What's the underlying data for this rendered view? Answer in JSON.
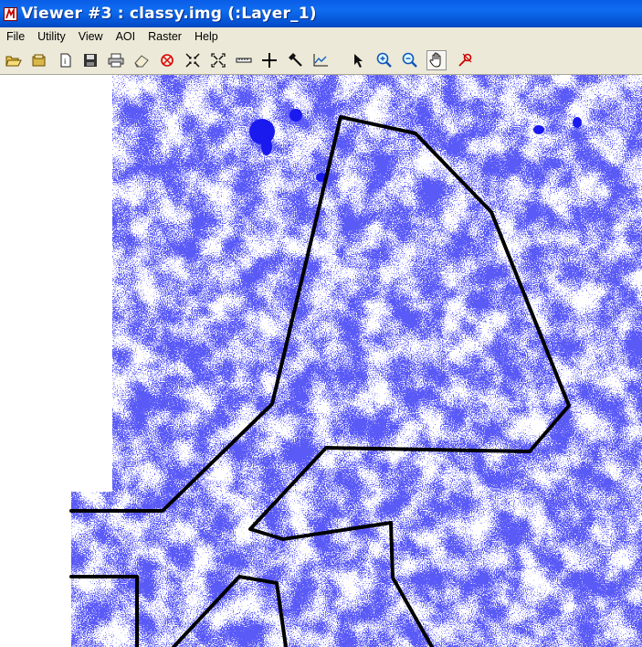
{
  "window": {
    "title": "Viewer #3 : classy.img (:Layer_1)"
  },
  "menu": [
    {
      "label": "File"
    },
    {
      "label": "Utility"
    },
    {
      "label": "View"
    },
    {
      "label": "AOI"
    },
    {
      "label": "Raster"
    },
    {
      "label": "Help"
    }
  ],
  "toolbar": {
    "tools": [
      {
        "icon": "open-folder-icon"
      },
      {
        "icon": "open-layer-icon"
      },
      {
        "icon": "info-page-icon"
      },
      {
        "icon": "save-disk-icon"
      },
      {
        "icon": "printer-icon"
      },
      {
        "icon": "eraser-icon"
      },
      {
        "icon": "red-cross-circle-icon"
      },
      {
        "icon": "zoom-in-arrows-icon"
      },
      {
        "icon": "zoom-out-arrows-icon"
      },
      {
        "icon": "measure-ruler-icon"
      },
      {
        "icon": "crosshair-plus-icon"
      },
      {
        "icon": "hammer-tools-icon"
      },
      {
        "icon": "profile-chart-icon"
      },
      {
        "icon": "select-arrow-icon"
      },
      {
        "icon": "zoom-in-magnifier-icon"
      },
      {
        "icon": "zoom-out-magnifier-icon"
      },
      {
        "icon": "hand-pan-icon",
        "active": true
      },
      {
        "icon": "red-pin-icon"
      }
    ]
  },
  "colors": {
    "titlebar": "#0a5ce6",
    "menubar_bg": "#ece9d8",
    "raster_class": "#1a1aee",
    "raster_background": "#ffffff",
    "aoi_outline": "#000000"
  }
}
